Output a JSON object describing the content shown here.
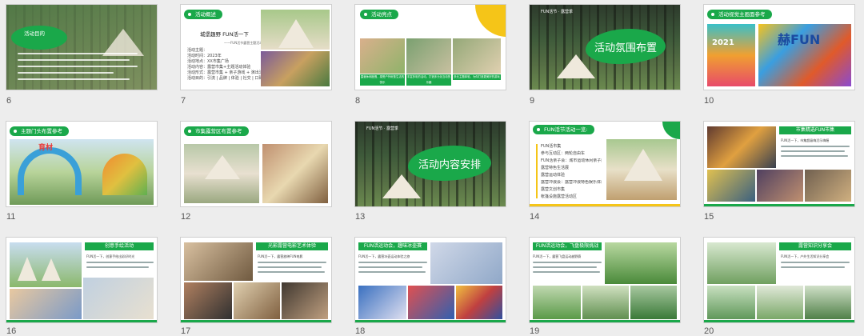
{
  "slides": [
    {
      "num": "6",
      "title": "活动目的"
    },
    {
      "num": "7",
      "title": "活动概述",
      "sub": "城堡趣野 FUN活一下",
      "sub2": "——FUN活节露营主题活动",
      "rows": [
        "活动主题：",
        "活动时间：2023年",
        "活动地点：XX市集广场",
        "活动内容：露营市集+主题活动体验",
        "活动形式：露营市集 + 亲子游戏 + 演出活动",
        "活动目的：引流 | 品牌 | 体验 | 社交 | 口碑 | 互动"
      ]
    },
    {
      "num": "8",
      "title": "活动亮点",
      "captions": [
        "露营休闲度假，感受户外帐篷生活的快乐",
        "丰富多彩的活动，打造多元化互动的乐趣",
        "多元主题体验，为你打造更美好的游玩"
      ]
    },
    {
      "num": "9",
      "title": "活动氛围布置",
      "logo": "FUN活节 · 露营季"
    },
    {
      "num": "10",
      "title": "活动视觉主画面参考",
      "year": "2021",
      "art": "赫FUN"
    },
    {
      "num": "11",
      "title": "主题门头布置参考",
      "gate": "育材"
    },
    {
      "num": "12",
      "title": "市集露营区布置参考"
    },
    {
      "num": "13",
      "title": "活动内容安排",
      "logo": "FUN活节 · 露营季"
    },
    {
      "num": "14",
      "title": "FUN活节活动一览:",
      "items": [
        "FUN活市集",
        "参与互动区：两轮自由车",
        "FUN活亲子会：城市运动休闲亲子面部大挑战",
        "露营特色生活展",
        "露营运动体验",
        "露营冲浪会：露营冲浪特色娱乐体验",
        "露营文创市集",
        "帐篷设施露营活动区"
      ]
    },
    {
      "num": "15",
      "title": "市集精选FUN市集",
      "lead": "FUN活一下，市集超级嗨活乐嗨喔"
    },
    {
      "num": "16",
      "title": "创意手绘活动",
      "lead": "FUN活一下，创意手绘出彩好时光"
    },
    {
      "num": "17",
      "title": "光影露营电影艺术体验",
      "lead": "FUN活一下，露营放映FUN电影"
    },
    {
      "num": "18",
      "title": "FUN活运动会，趣味冰壶赛",
      "lead": "FUN活一下，露营冰壶运动体验之旅"
    },
    {
      "num": "19",
      "title": "FUN活运动会，飞盘极限挑战",
      "lead": "FUN活一下，露营飞盘运动越野赛"
    },
    {
      "num": "20",
      "title": "露营知识分享会",
      "lead": "FUN活一下，户外生活知识分享会"
    }
  ],
  "colors": {
    "accent": "#1aa84a",
    "yellow": "#f5c518",
    "bg": "#ededed"
  }
}
